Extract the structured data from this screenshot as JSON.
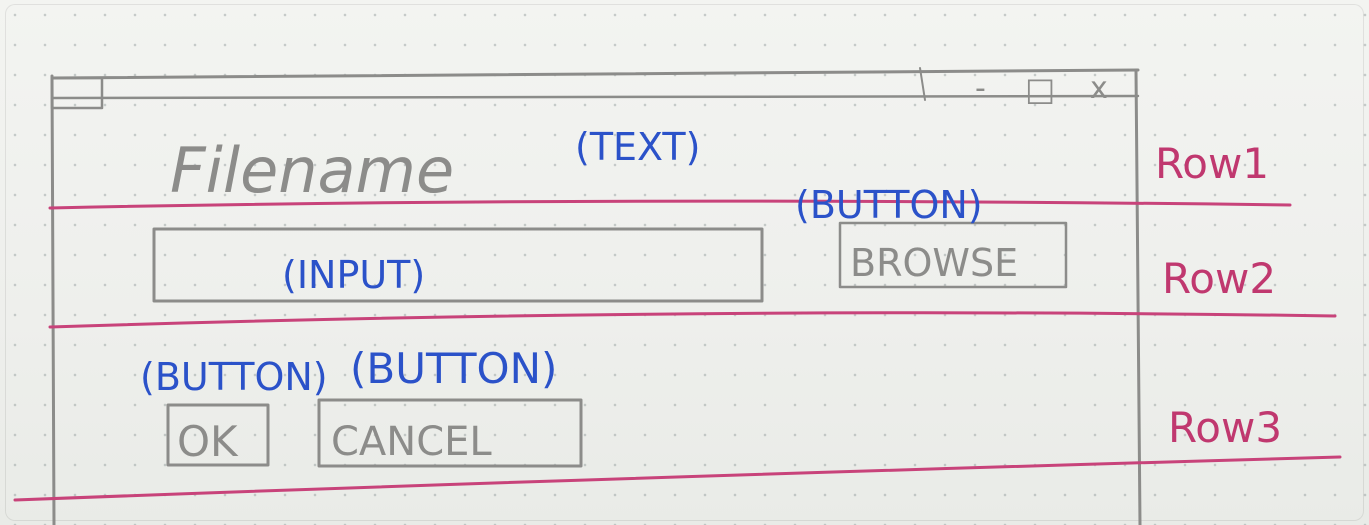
{
  "window": {
    "controls": [
      "-",
      "□",
      "x"
    ]
  },
  "form": {
    "label_text": "Filename",
    "browse_label": "BROWSE",
    "ok_label": "OK",
    "cancel_label": "CANCEL"
  },
  "annotations": {
    "text": "(TEXT)",
    "input": "(INPUT)",
    "browse_button": "(BUTTON)",
    "ok_button": "(BUTTON)",
    "cancel_button": "(BUTTON)"
  },
  "rows": {
    "row1": "Row1",
    "row2": "Row2",
    "row3": "Row3"
  },
  "colors": {
    "pencil": "#8c8c8a",
    "annotation_blue": "#2b52c9",
    "row_red": "#c0386f"
  }
}
